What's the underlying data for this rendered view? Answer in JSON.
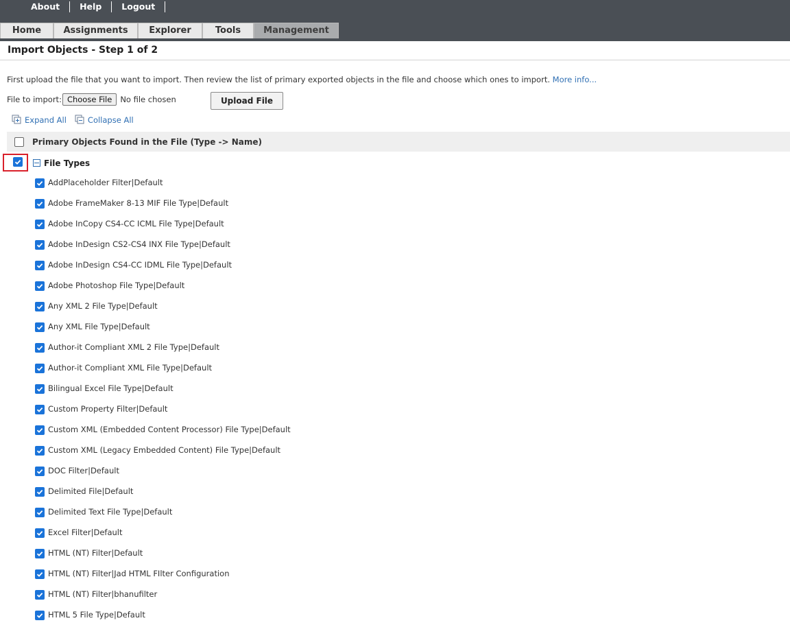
{
  "nav": {
    "top_links": [
      "About",
      "Help",
      "Logout"
    ],
    "tabs": [
      {
        "label": "Home",
        "active": false
      },
      {
        "label": "Assignments",
        "active": false
      },
      {
        "label": "Explorer",
        "active": false
      },
      {
        "label": "Tools",
        "active": false
      },
      {
        "label": "Management",
        "active": true
      }
    ]
  },
  "page": {
    "title": "Import Objects - Step 1 of 2",
    "intro": "First upload the file that you want to import. Then review the list of primary exported objects in the file and choose which ones to import.",
    "more_info": "More info..."
  },
  "upload": {
    "label": "File to import:",
    "choose_label": "Choose File",
    "no_file": "No file chosen",
    "upload_label": "Upload File"
  },
  "tree": {
    "expand_all": "Expand All",
    "collapse_all": "Collapse All",
    "header": "Primary Objects Found in the File (Type -> Name)",
    "header_checked": false,
    "group": {
      "label": "File Types",
      "checked": true
    },
    "items": [
      "AddPlaceholder Filter|Default",
      "Adobe FrameMaker 8-13 MIF File Type|Default",
      "Adobe InCopy CS4-CC ICML File Type|Default",
      "Adobe InDesign CS2-CS4 INX File Type|Default",
      "Adobe InDesign CS4-CC IDML File Type|Default",
      "Adobe Photoshop File Type|Default",
      "Any XML 2 File Type|Default",
      "Any XML File Type|Default",
      "Author-it Compliant XML 2 File Type|Default",
      "Author-it Compliant XML File Type|Default",
      "Bilingual Excel File Type|Default",
      "Custom Property Filter|Default",
      "Custom XML (Embedded Content Processor) File Type|Default",
      "Custom XML (Legacy Embedded Content) File Type|Default",
      "DOC Filter|Default",
      "Delimited File|Default",
      "Delimited Text File Type|Default",
      "Excel Filter|Default",
      "HTML (NT) Filter|Default",
      "HTML (NT) Filter|Jad HTML FIlter Configuration",
      "HTML (NT) Filter|bhanufilter",
      "HTML 5 File Type|Default"
    ]
  },
  "colors": {
    "topbar": "#4a4f55",
    "link": "#2f6fb3",
    "checkbox": "#1a73d9",
    "highlight": "#d9202a"
  }
}
